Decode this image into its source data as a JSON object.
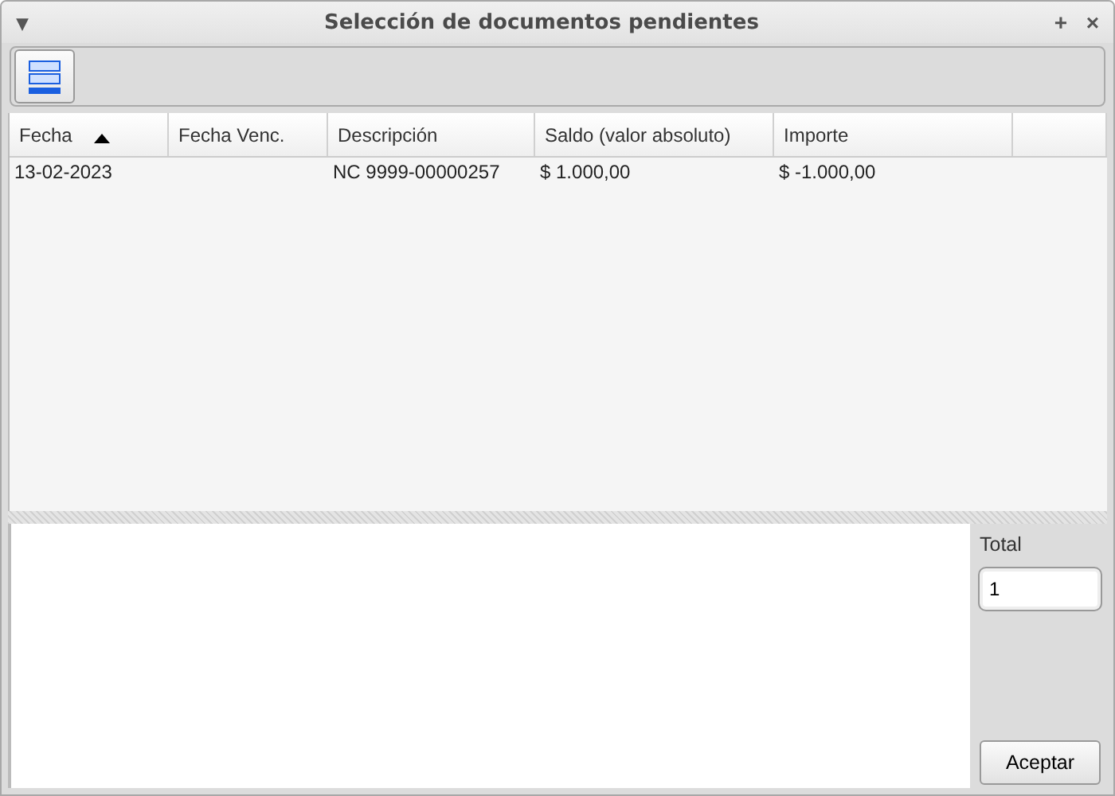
{
  "window": {
    "title": "Selección de documentos pendientes",
    "menu_glyph": "▾",
    "buttons": [
      "+",
      "×"
    ]
  },
  "table": {
    "columns": [
      {
        "label": "Fecha",
        "sorted": true
      },
      {
        "label": "Fecha Venc.",
        "sorted": false
      },
      {
        "label": "Descripción",
        "sorted": false
      },
      {
        "label": "Saldo (valor absoluto)",
        "sorted": false
      },
      {
        "label": "Importe",
        "sorted": false
      }
    ],
    "rows": [
      [
        "13-02-2023",
        "",
        "NC 9999-00000257",
        "$ 1.000,00",
        "$ -1.000,00"
      ]
    ]
  },
  "total": {
    "label": "Total",
    "value": "1"
  },
  "buttons": [
    "Aceptar"
  ]
}
